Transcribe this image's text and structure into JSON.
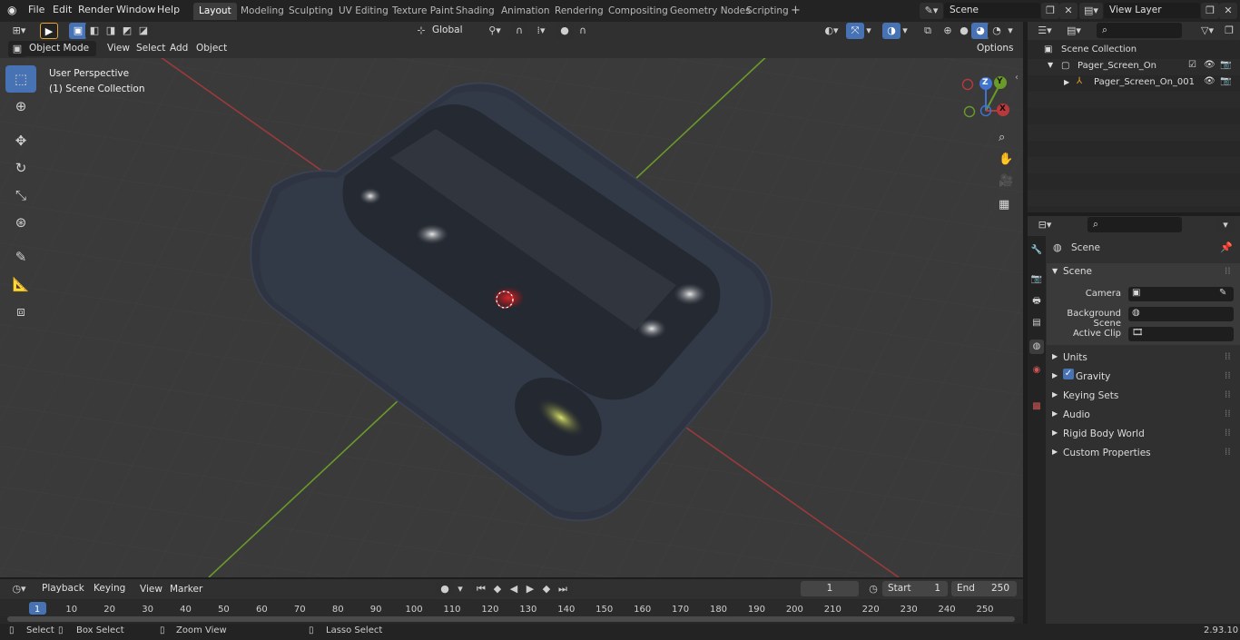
{
  "topbar": {
    "menus": [
      "File",
      "Edit",
      "Render",
      "Window",
      "Help"
    ],
    "workspaces": [
      "Layout",
      "Modeling",
      "Sculpting",
      "UV Editing",
      "Texture Paint",
      "Shading",
      "Animation",
      "Rendering",
      "Compositing",
      "Geometry Nodes",
      "Scripting"
    ],
    "active_workspace": "Layout",
    "add_tab": "+",
    "scene_name": "Scene",
    "view_layer": "View Layer"
  },
  "viewport_header": {
    "mode": "Object Mode",
    "menus": [
      "View",
      "Select",
      "Add",
      "Object"
    ],
    "orientation": "Global",
    "options_label": "Options"
  },
  "viewport": {
    "overlay_line1": "User Perspective",
    "overlay_line2": "(1) Scene Collection",
    "gizmo": {
      "x": "X",
      "y": "Y",
      "z": "Z"
    }
  },
  "toolbar": {
    "tools": [
      "select-box-icon",
      "cursor-icon",
      "move-icon",
      "rotate-icon",
      "scale-icon",
      "transform-icon",
      "annotate-icon",
      "measure-icon",
      "add-cube-icon"
    ]
  },
  "outliner": {
    "root": "Scene Collection",
    "items": [
      {
        "name": "Pager_Screen_On",
        "level": 1
      },
      {
        "name": "Pager_Screen_On_001",
        "level": 2
      }
    ]
  },
  "properties": {
    "context_title": "Scene",
    "section_title": "Scene",
    "fields": [
      {
        "label": "Camera"
      },
      {
        "label": "Background Scene"
      },
      {
        "label": "Active Clip"
      }
    ],
    "panels": [
      "Units",
      "Gravity",
      "Keying Sets",
      "Audio",
      "Rigid Body World",
      "Custom Properties"
    ],
    "gravity_checked": true
  },
  "timeline": {
    "menus": [
      "Playback",
      "Keying",
      "View",
      "Marker"
    ],
    "current_frame": "1",
    "start_label": "Start",
    "start_value": "1",
    "end_label": "End",
    "end_value": "250",
    "ticks": [
      "1",
      "10",
      "20",
      "30",
      "40",
      "50",
      "60",
      "70",
      "80",
      "90",
      "100",
      "110",
      "120",
      "130",
      "140",
      "150",
      "160",
      "170",
      "180",
      "190",
      "200",
      "210",
      "220",
      "230",
      "240",
      "250"
    ]
  },
  "statusbar": {
    "select": "Select",
    "box_select": "Box Select",
    "zoom_view": "Zoom View",
    "lasso_select": "Lasso Select",
    "version": "2.93.10"
  },
  "colors": {
    "accent": "#4772b3",
    "x_axis": "#b8393b",
    "y_axis": "#6b9a2a",
    "z_axis": "#3f75d0"
  }
}
